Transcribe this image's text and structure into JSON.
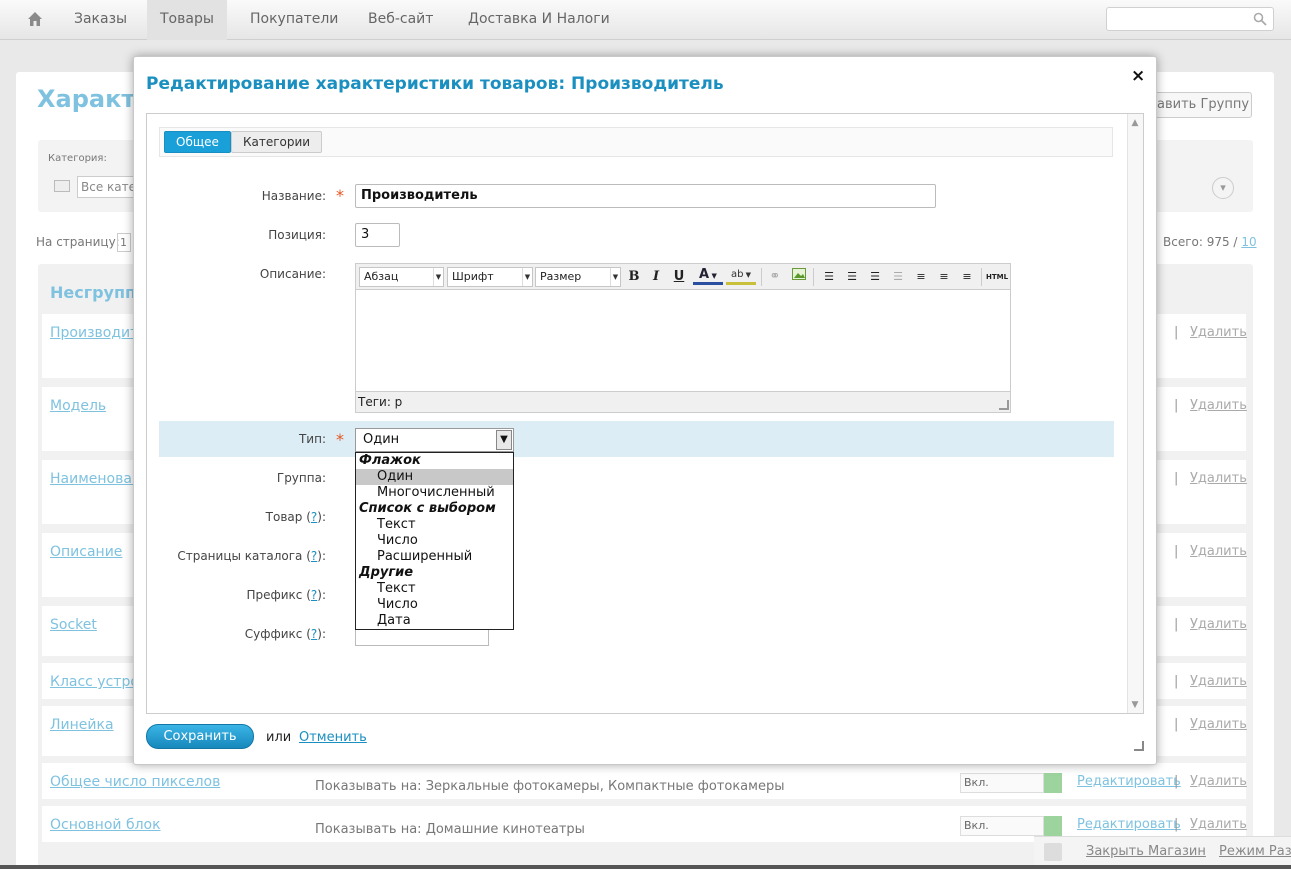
{
  "nav": {
    "items": [
      "Заказы",
      "Товары",
      "Покупатели",
      "Веб-сайт",
      "Доставка И Налоги"
    ],
    "active": "Товары"
  },
  "background": {
    "title": "Характе",
    "add_group": "бавить Группу",
    "filter_label": "Категория:",
    "filter_value": "Все кате",
    "per_page_label": "На страницу:",
    "per_page_value": "1",
    "total_label": "Всего: 975 /",
    "total_link": "10",
    "group_title": "Несгруппи",
    "rows": [
      {
        "name": "Производит",
        "show": "",
        "status": "",
        "edit": "",
        "sep": "|",
        "delete": "Удалить"
      },
      {
        "name": "Модель",
        "show": "",
        "status": "",
        "edit": "",
        "sep": "|",
        "delete": "Удалить"
      },
      {
        "name": "Наименован",
        "show": "",
        "status": "",
        "edit": "",
        "sep": "|",
        "delete": "Удалить"
      },
      {
        "name": "Описание",
        "show": "",
        "status": "",
        "edit": "",
        "sep": "|",
        "delete": "Удалить"
      },
      {
        "name": "Socket",
        "show": "",
        "status": "",
        "edit": "",
        "sep": "|",
        "delete": "Удалить"
      },
      {
        "name": "Класс устро",
        "show": "",
        "status": "",
        "edit": "",
        "sep": "|",
        "delete": "Удалить"
      },
      {
        "name": "Линейка",
        "show": "",
        "status": "",
        "edit": "",
        "sep": "|",
        "delete": "Удалить"
      },
      {
        "name": "Общее число пикселов",
        "show": "Показывать на: Зеркальные фотокамеры, Компактные фотокамеры",
        "status": "Вкл.",
        "edit": "Редактировать",
        "sep": "|",
        "delete": "Удалить"
      },
      {
        "name": "Основной блок",
        "show": "Показывать на: Домашние кинотеатры",
        "status": "Вкл.",
        "edit": "Редактировать",
        "sep": "|",
        "delete": "Удалить"
      }
    ],
    "footer": {
      "close_store": "Закрыть Магазин",
      "mode": "Режим Разр"
    }
  },
  "modal": {
    "title": "Редактирование характеристики товаров: Производитель",
    "close": "×",
    "tabs": [
      "Общее",
      "Категории"
    ],
    "fields": {
      "name_label": "Название:",
      "name_value": "Производитель",
      "position_label": "Позиция:",
      "position_value": "3",
      "description_label": "Описание:",
      "type_label": "Тип:",
      "group_label": "Группа:",
      "product_label": "Товар",
      "catalog_label": "Страницы каталога",
      "prefix_label": "Префикс",
      "suffix_label": "Суффикс",
      "help": "?"
    },
    "editor": {
      "format": "Абзац",
      "font": "Шрифт",
      "size": "Размер",
      "status": "Теги: p",
      "buttons": {
        "bold": "B",
        "italic": "I",
        "underline": "U",
        "text_color": "A",
        "highlight": "ab",
        "html": "HTML"
      }
    },
    "type_select": {
      "value": "Один",
      "groups": [
        {
          "label": "Флажок",
          "options": [
            "Один",
            "Многочисленный"
          ]
        },
        {
          "label": "Список с выбором",
          "options": [
            "Текст",
            "Число",
            "Расширенный"
          ]
        },
        {
          "label": "Другие",
          "options": [
            "Текст",
            "Число",
            "Дата"
          ]
        }
      ]
    },
    "actions": {
      "save": "Сохранить",
      "or": "или",
      "cancel": "Отменить"
    }
  }
}
